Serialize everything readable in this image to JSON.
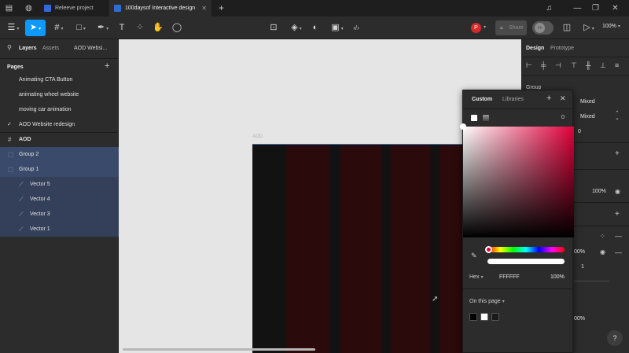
{
  "titlebar": {
    "tabs": [
      {
        "label": "Releeve project",
        "active": false
      },
      {
        "label": "100daysof Interactive design",
        "active": true
      }
    ]
  },
  "toolbar": {
    "avatar_letter": "P",
    "share_label": "Share",
    "zoom": "100%"
  },
  "left": {
    "tab_layers": "Layers",
    "tab_assets": "Assets",
    "page_selector": "AOD Websi...",
    "pages_title": "Pages",
    "pages": [
      {
        "label": "Animating CTA Button",
        "current": false
      },
      {
        "label": "animating wheel website",
        "current": false
      },
      {
        "label": "moving car animation",
        "current": false
      },
      {
        "label": "AOD Website redesign",
        "current": true
      }
    ],
    "layers": [
      {
        "label": "AOD",
        "level": 0
      },
      {
        "label": "Group 2",
        "level": 1
      },
      {
        "label": "Group 1",
        "level": 1
      },
      {
        "label": "Vector 5",
        "level": 2
      },
      {
        "label": "Vector 4",
        "level": 2
      },
      {
        "label": "Vector 3",
        "level": 2
      },
      {
        "label": "Vector 1",
        "level": 2
      }
    ]
  },
  "canvas": {
    "frame_label": "AOD",
    "stripe_color": "#2a0a0a",
    "dark_color": "#121212"
  },
  "right": {
    "tab_design": "Design",
    "tab_prototype": "Prototype",
    "group_label": "Group",
    "mixed1": "Mixed",
    "mixed2": "Mixed",
    "zero": "0",
    "percent1": "100%",
    "percent2": "00%",
    "one": "1",
    "percent3": "00%",
    "help": "?"
  },
  "picker": {
    "tab_custom": "Custom",
    "tab_libraries": "Libraries",
    "rotation": "0",
    "hex_label": "Hex",
    "hex_value": "FFFFFF",
    "opacity": "100%",
    "on_page_label": "On this page",
    "swatches": [
      "#000000",
      "#ffffff",
      "#1a1a1a"
    ],
    "hue_color": "#e0003a"
  }
}
